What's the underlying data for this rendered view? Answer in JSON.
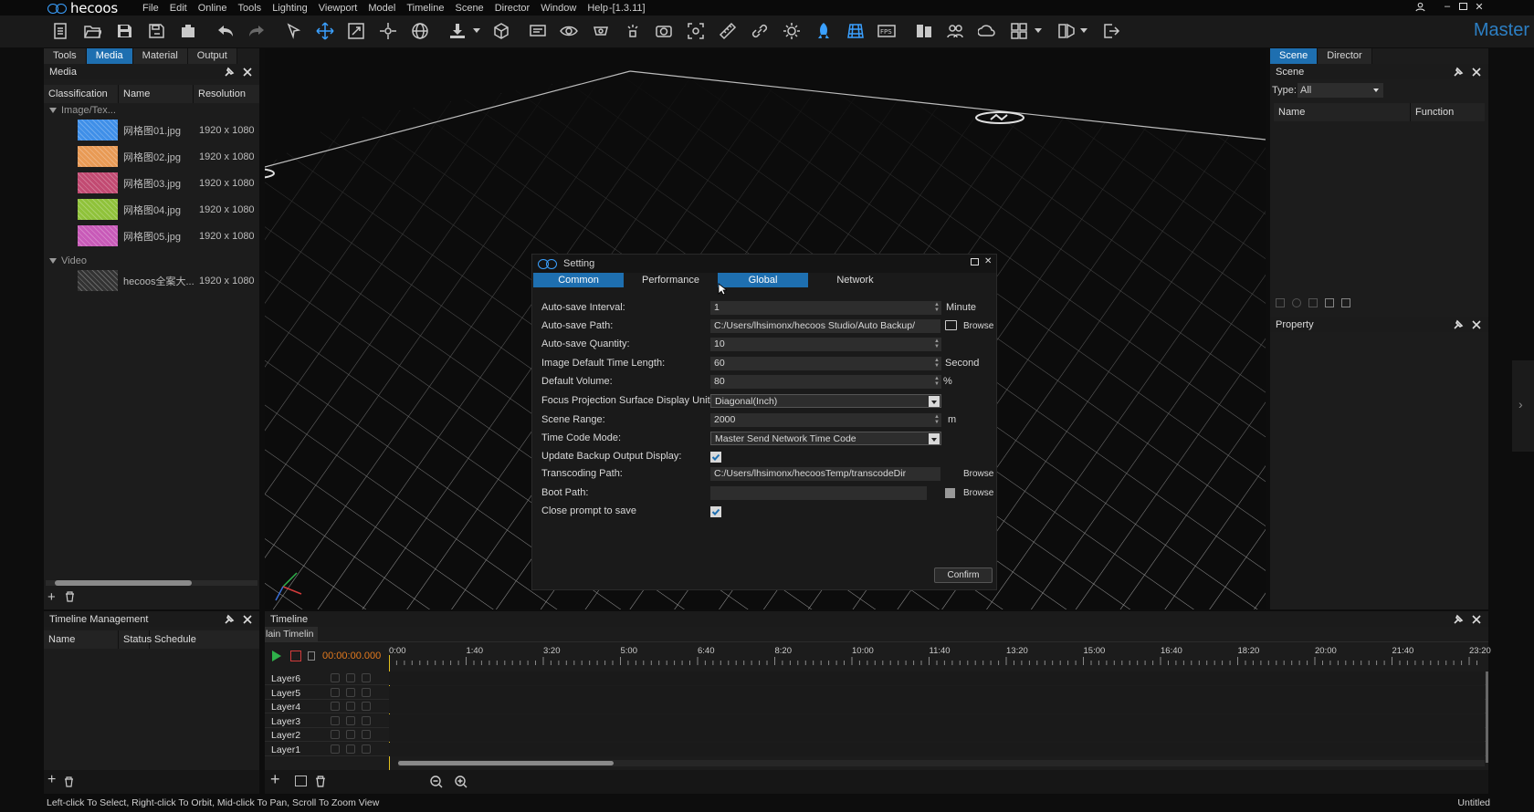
{
  "app": {
    "brand": "hecoos",
    "version": "-[1.3.11]",
    "mode_label": "Master",
    "menu": [
      "File",
      "Edit",
      "Online",
      "Tools",
      "Lighting",
      "Viewport",
      "Model",
      "Timeline",
      "Scene",
      "Director",
      "Window",
      "Help"
    ]
  },
  "window_controls": {
    "user_icon": "user-icon",
    "minimize": "–",
    "maximize": "▫",
    "close": "✕"
  },
  "toolbar_icons": [
    "new-file-icon",
    "open-folder-icon",
    "save-icon",
    "save-as-icon",
    "export-icon",
    "undo-icon",
    "redo-icon",
    "select-arrow-icon",
    "move-icon",
    "scale-icon",
    "rotate-icon",
    "globe-icon",
    "import-icon",
    "cube-icon",
    "monitor-icon",
    "eye-icon",
    "projector-icon",
    "light-icon",
    "camera-icon",
    "focus-icon",
    "ruler-icon",
    "link-icon",
    "sun-icon",
    "rocket-icon",
    "grid-icon",
    "fps-icon",
    "layers-icon",
    "group-icon",
    "weather-icon",
    "layout-icon",
    "split-view-icon",
    "exit-icon"
  ],
  "left_panel": {
    "tabs": [
      "Tools",
      "Media",
      "Material",
      "Output"
    ],
    "active_tab": "Media",
    "title": "Media",
    "columns": [
      "Classification",
      "Name",
      "Resolution"
    ],
    "groups": [
      {
        "label": "Image/Tex...",
        "items": [
          {
            "name": "网格图01.jpg",
            "resolution": "1920 x 1080",
            "thumb": "#3f8fe8"
          },
          {
            "name": "网格图02.jpg",
            "resolution": "1920 x 1080",
            "thumb": "#e89a55"
          },
          {
            "name": "网格图03.jpg",
            "resolution": "1920 x 1080",
            "thumb": "#c24a72"
          },
          {
            "name": "网格图04.jpg",
            "resolution": "1920 x 1080",
            "thumb": "#8fc23a"
          },
          {
            "name": "网格图05.jpg",
            "resolution": "1920 x 1080",
            "thumb": "#c85ab8"
          }
        ]
      },
      {
        "label": "Video",
        "items": [
          {
            "name": "hecoos全案大...",
            "resolution": "1920 x 1080",
            "thumb": "#333333"
          }
        ]
      }
    ]
  },
  "right_panel": {
    "tabs": [
      "Scene",
      "Director"
    ],
    "active_tab": "Scene",
    "title": "Scene",
    "type_label": "Type:",
    "type_value": "All",
    "columns": [
      "Name",
      "Function"
    ],
    "property_title": "Property"
  },
  "dialog": {
    "title": "Setting",
    "tabs": [
      "Common",
      "Performance",
      "Global",
      "Network"
    ],
    "fields": [
      {
        "label": "Auto-save Interval:",
        "value": "1",
        "unit": "Minute",
        "kind": "spin"
      },
      {
        "label": "Auto-save Path:",
        "value": "C:/Users/lhsimonx/hecoos Studio/Auto Backup/",
        "unit": "Browse",
        "kind": "path-folder"
      },
      {
        "label": "Auto-save Quantity:",
        "value": "10",
        "unit": "",
        "kind": "spin"
      },
      {
        "label": "Image Default Time Length:",
        "value": "60",
        "unit": "Second",
        "kind": "spin"
      },
      {
        "label": "Default Volume:",
        "value": "80",
        "unit": "%",
        "kind": "spin"
      },
      {
        "label": "Focus Projection Surface Display Unit:",
        "value": "Diagonal(Inch)",
        "unit": "",
        "kind": "dropdown"
      },
      {
        "label": "Scene Range:",
        "value": "2000",
        "unit": "m",
        "kind": "spin"
      },
      {
        "label": "Time Code Mode:",
        "value": "Master Send Network Time Code",
        "unit": "",
        "kind": "dropdown"
      },
      {
        "label": "Update Backup Output Display:",
        "value": "",
        "unit": "",
        "kind": "check"
      },
      {
        "label": "Transcoding Path:",
        "value": "C:/Users/lhsimonx/hecoosTemp/transcodeDir",
        "unit": "Browse",
        "kind": "path"
      },
      {
        "label": "Boot Path:",
        "value": "",
        "unit": "Browse",
        "kind": "path-box"
      },
      {
        "label": "Close prompt to save",
        "value": "",
        "unit": "",
        "kind": "check"
      }
    ],
    "confirm_label": "Confirm"
  },
  "timeline_mgmt": {
    "title": "Timeline Management",
    "columns": [
      "Name",
      "Status",
      "Schedule"
    ]
  },
  "timeline": {
    "title": "Timeline",
    "tab": "lain Timelin",
    "timecode": "00:00:00.000",
    "ticks": [
      "0:00",
      "1:40",
      "3:20",
      "5:00",
      "6:40",
      "8:20",
      "10:00",
      "11:40",
      "13:20",
      "15:00",
      "16:40",
      "18:20",
      "20:00",
      "21:40",
      "23:20"
    ],
    "layers": [
      "Layer6",
      "Layer5",
      "Layer4",
      "Layer3",
      "Layer2",
      "Layer1"
    ]
  },
  "status": {
    "hint": "Left-click To Select, Right-click To Orbit, Mid-click To Pan, Scroll To Zoom View",
    "document": "Untitled"
  }
}
